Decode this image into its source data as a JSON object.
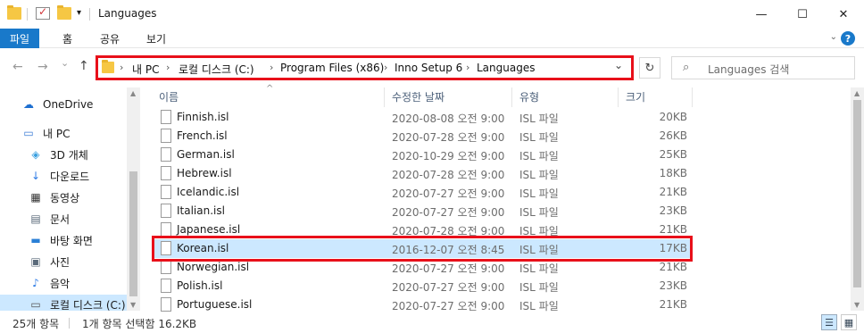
{
  "window": {
    "title": "Languages",
    "minimize": "—",
    "maximize": "☐",
    "close": "✕"
  },
  "ribbon": {
    "tabs": [
      "파일",
      "홈",
      "공유",
      "보기"
    ],
    "help": "?"
  },
  "address": {
    "crumbs": [
      "내 PC",
      "로컬 디스크 (C:)",
      "Program Files (x86)",
      "Inno Setup 6",
      "Languages"
    ],
    "sep": "›",
    "dropdown": "⌄",
    "refresh": "↻",
    "root_chevron": "›"
  },
  "search": {
    "placeholder": "Languages 검색",
    "icon": "⌕"
  },
  "nav": {
    "back": "←",
    "forward": "→",
    "recent": "⌄",
    "up": "↑",
    "items": [
      {
        "label": "OneDrive",
        "icon": "cloud-icon",
        "glyph": "☁",
        "color": "#1e6fd0"
      },
      {
        "label": "내 PC",
        "icon": "pc-icon",
        "glyph": "▭",
        "color": "#3a7bd5"
      },
      {
        "label": "3D 개체",
        "icon": "cube-icon",
        "glyph": "◈",
        "color": "#3aa0e0"
      },
      {
        "label": "다운로드",
        "icon": "download-icon",
        "glyph": "↓",
        "color": "#2d7be5"
      },
      {
        "label": "동영상",
        "icon": "video-icon",
        "glyph": "▦",
        "color": "#333333"
      },
      {
        "label": "문서",
        "icon": "document-icon",
        "glyph": "▤",
        "color": "#5a6a7a"
      },
      {
        "label": "바탕 화면",
        "icon": "desktop-icon",
        "glyph": "▬",
        "color": "#2b80d6"
      },
      {
        "label": "사진",
        "icon": "pictures-icon",
        "glyph": "▣",
        "color": "#5a6a7a"
      },
      {
        "label": "음악",
        "icon": "music-icon",
        "glyph": "♪",
        "color": "#2d7be5"
      },
      {
        "label": "로컬 디스크 (C:)",
        "icon": "disk-icon",
        "glyph": "▭",
        "color": "#555555"
      }
    ]
  },
  "columns": {
    "name": "이름",
    "date": "수정한 날짜",
    "type": "유형",
    "size": "크기",
    "sort": "^"
  },
  "files": [
    {
      "name": "Finnish.isl",
      "date": "2020-08-08 오전 9:00",
      "type": "ISL 파일",
      "size": "20KB"
    },
    {
      "name": "French.isl",
      "date": "2020-07-28 오전 9:00",
      "type": "ISL 파일",
      "size": "26KB"
    },
    {
      "name": "German.isl",
      "date": "2020-10-29 오전 9:00",
      "type": "ISL 파일",
      "size": "25KB"
    },
    {
      "name": "Hebrew.isl",
      "date": "2020-07-28 오전 9:00",
      "type": "ISL 파일",
      "size": "18KB"
    },
    {
      "name": "Icelandic.isl",
      "date": "2020-07-27 오전 9:00",
      "type": "ISL 파일",
      "size": "21KB"
    },
    {
      "name": "Italian.isl",
      "date": "2020-07-27 오전 9:00",
      "type": "ISL 파일",
      "size": "23KB"
    },
    {
      "name": "Japanese.isl",
      "date": "2020-07-28 오전 9:00",
      "type": "ISL 파일",
      "size": "21KB"
    },
    {
      "name": "Korean.isl",
      "date": "2016-12-07 오전 8:45",
      "type": "ISL 파일",
      "size": "17KB",
      "selected": true
    },
    {
      "name": "Norwegian.isl",
      "date": "2020-07-27 오전 9:00",
      "type": "ISL 파일",
      "size": "21KB"
    },
    {
      "name": "Polish.isl",
      "date": "2020-07-27 오전 9:00",
      "type": "ISL 파일",
      "size": "23KB"
    },
    {
      "name": "Portuguese.isl",
      "date": "2020-07-27 오전 9:00",
      "type": "ISL 파일",
      "size": "21KB"
    }
  ],
  "status": {
    "count": "25개 항목",
    "selection": "1개 항목 선택함 16.2KB"
  },
  "colors": {
    "accent": "#1979ca",
    "highlight": "#e8101a",
    "selection": "#cce8ff"
  }
}
